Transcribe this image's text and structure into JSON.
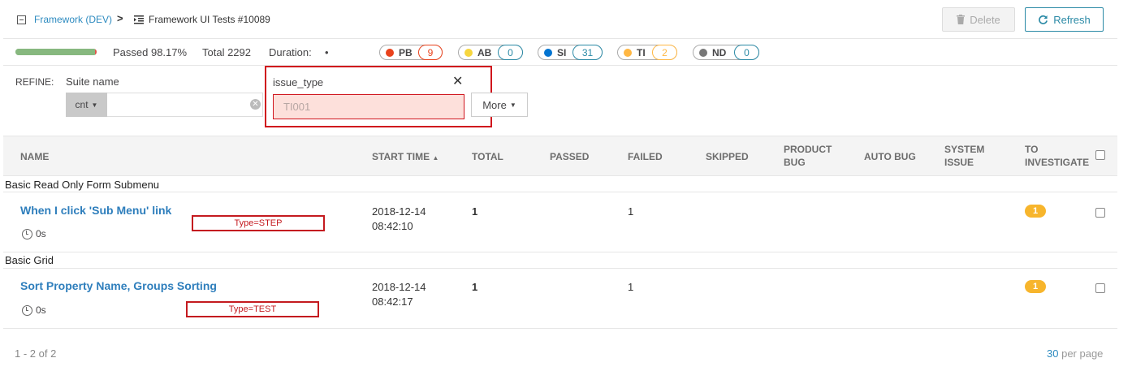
{
  "header": {
    "launch_link": "Framework (DEV)",
    "separator": ">",
    "current": "Framework UI Tests #10089",
    "delete_label": "Delete",
    "refresh_label": "Refresh"
  },
  "stats": {
    "passed_percent": 98.17,
    "passed": "Passed 98.17%",
    "total": "Total 2292",
    "duration_label": "Duration:",
    "duration_value": "•"
  },
  "defects": [
    {
      "code": "PB",
      "count": "9",
      "color": "#e9421c",
      "border": "#e9421c"
    },
    {
      "code": "AB",
      "count": "0",
      "color": "#f7d63e",
      "border": "#2b8aa6"
    },
    {
      "code": "SI",
      "count": "31",
      "color": "#0274d1",
      "border": "#2b8aa6"
    },
    {
      "code": "TI",
      "count": "2",
      "color": "#ffb743",
      "border": "#ffb743"
    },
    {
      "code": "ND",
      "count": "0",
      "color": "#777777",
      "border": "#2b8aa6"
    }
  ],
  "refine": {
    "label": "REFINE:",
    "suite_label": "Suite name",
    "condition": "cnt",
    "suite_value": "",
    "more_label": "More",
    "issue_popup": {
      "title": "issue_type",
      "placeholder": "TI001"
    }
  },
  "table": {
    "columns": {
      "name": "NAME",
      "start_time": "START TIME",
      "total": "TOTAL",
      "passed": "PASSED",
      "failed": "FAILED",
      "skipped": "SKIPPED",
      "product_bug_1": "PRODUCT",
      "product_bug_2": "BUG",
      "auto_bug": "AUTO BUG",
      "system_issue_1": "SYSTEM",
      "system_issue_2": "ISSUE",
      "to_investigate_1": "TO",
      "to_investigate_2": "INVESTIGATE"
    },
    "groups": [
      {
        "label": "Basic Read Only Form Submenu",
        "row": {
          "name": "When I click 'Sub Menu' link",
          "duration": "0s",
          "type": "Type=STEP",
          "date": "2018-12-14",
          "time": "08:42:10",
          "total": "1",
          "failed": "1",
          "to_investigate": "1"
        }
      },
      {
        "label": "Basic Grid",
        "row": {
          "name": "Sort Property Name, Groups Sorting",
          "duration": "0s",
          "type": "Type=TEST",
          "date": "2018-12-14",
          "time": "08:42:17",
          "total": "1",
          "failed": "1",
          "to_investigate": "1"
        }
      }
    ]
  },
  "footer": {
    "range": "1 - 2 of 2",
    "per_page_value": "30",
    "per_page_label": "per page"
  }
}
